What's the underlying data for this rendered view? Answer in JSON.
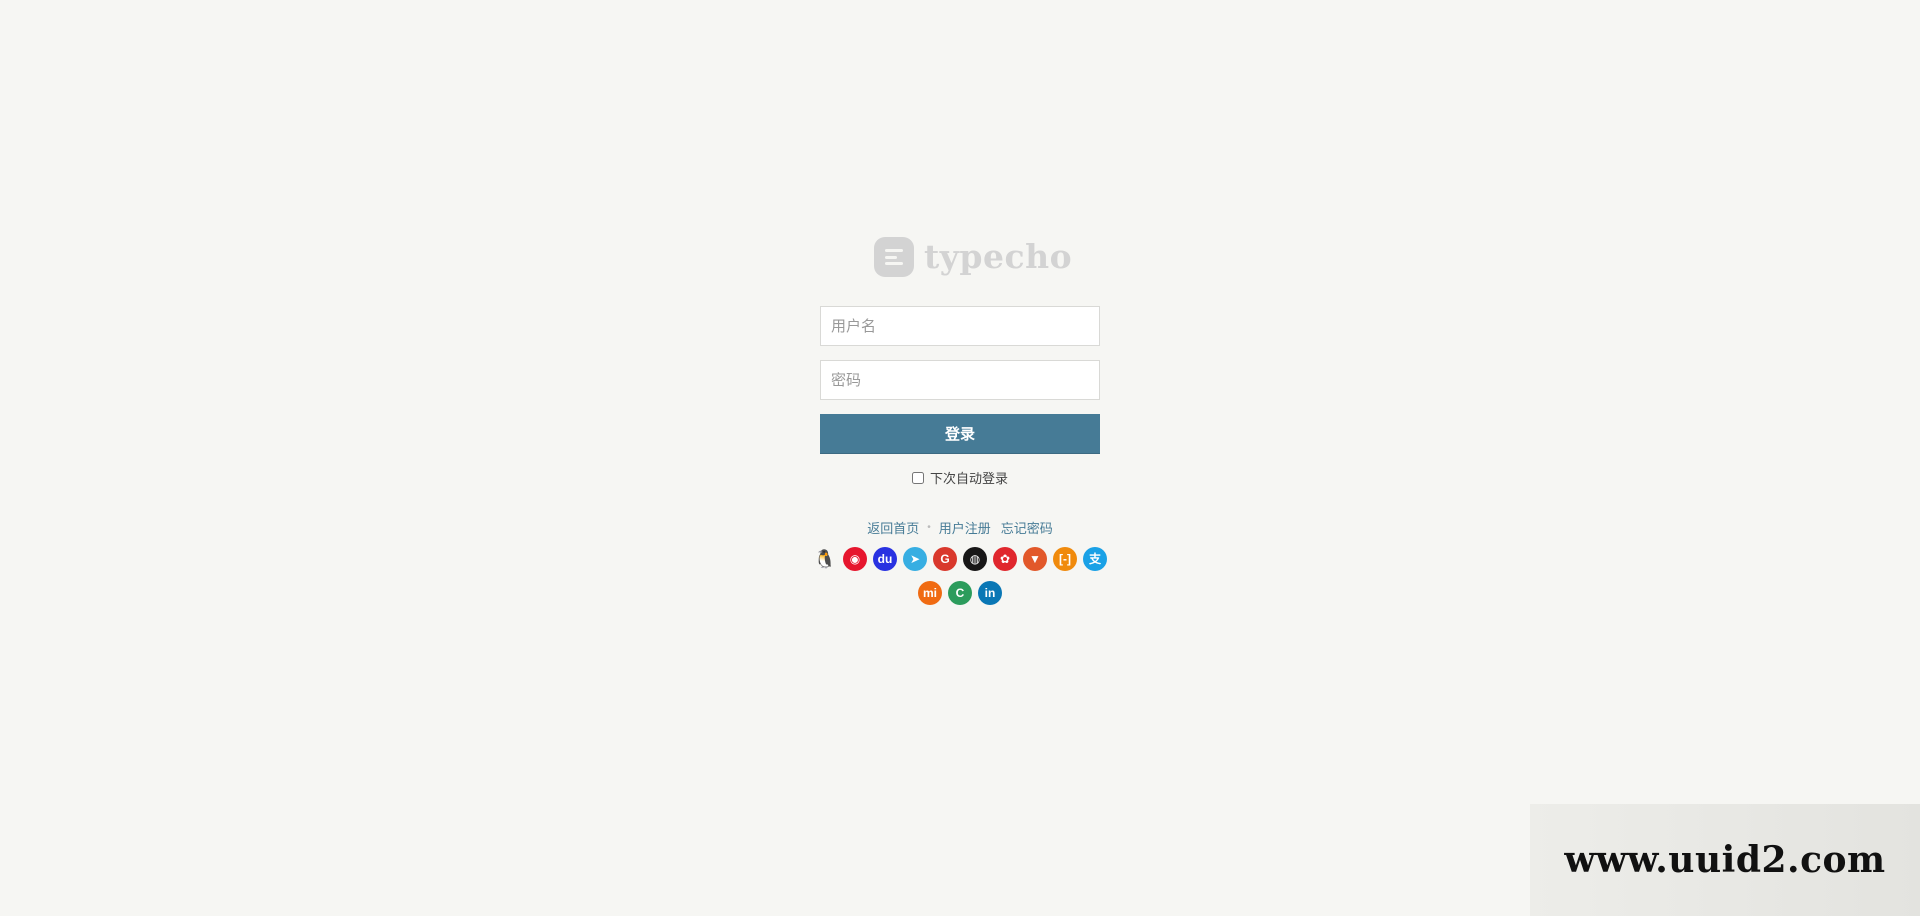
{
  "logo": {
    "text": "typecho",
    "icon": "typecho-logo-icon",
    "color": "#d3d3d3"
  },
  "form": {
    "username_placeholder": "用户名",
    "username_value": "",
    "password_placeholder": "密码",
    "password_value": "",
    "submit_label": "登录",
    "remember_label": "下次自动登录",
    "remember_checked": false
  },
  "links": [
    {
      "label": "返回首页"
    },
    {
      "label": "用户注册"
    },
    {
      "label": "忘记密码"
    }
  ],
  "social_icons": [
    {
      "name": "qq-icon",
      "glyph": "🐧",
      "color": ""
    },
    {
      "name": "weibo-icon",
      "glyph": "◉",
      "color": "#e6162d"
    },
    {
      "name": "baidu-icon",
      "glyph": "du",
      "color": "#2932e1"
    },
    {
      "name": "telegram-icon",
      "glyph": "➤",
      "color": "#37aee2"
    },
    {
      "name": "google-icon",
      "glyph": "G",
      "color": "#d9382c"
    },
    {
      "name": "github-icon",
      "glyph": "◍",
      "color": "#181717"
    },
    {
      "name": "huawei-icon",
      "glyph": "✿",
      "color": "#e0272d"
    },
    {
      "name": "gitlab-icon",
      "glyph": "▼",
      "color": "#e2582a"
    },
    {
      "name": "aliyun-icon",
      "glyph": "[-]",
      "color": "#f08a0c"
    },
    {
      "name": "alipay-icon",
      "glyph": "支",
      "color": "#1aa1e6"
    },
    {
      "name": "xiaomi-icon",
      "glyph": "mi",
      "color": "#f06b12"
    },
    {
      "name": "coding-icon",
      "glyph": "C",
      "color": "#2c9c5c"
    },
    {
      "name": "linkedin-icon",
      "glyph": "in",
      "color": "#0a77b5"
    }
  ],
  "watermark": {
    "text": "www.uuid2.com"
  },
  "colors": {
    "background": "#f6f6f3",
    "accent": "#467b96"
  }
}
